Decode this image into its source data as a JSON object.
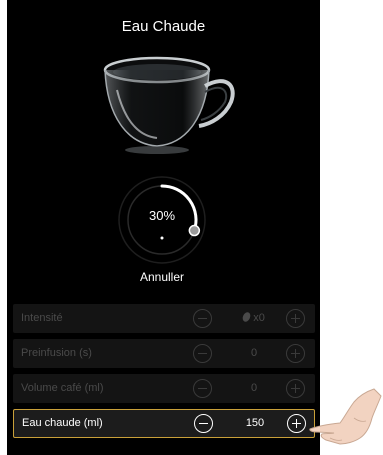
{
  "screen": {
    "title": "Eau Chaude"
  },
  "dial": {
    "percent_text": "30%",
    "progress": 0.3
  },
  "cancel_label": "Annuller",
  "settings": [
    {
      "label": "Intensité",
      "value": "x0",
      "icon": "coffee-bean-icon",
      "active": false
    },
    {
      "label": "Preinfusion (s)",
      "value": "0",
      "active": false
    },
    {
      "label": "Volume café (ml)",
      "value": "0",
      "active": false
    },
    {
      "label": "Eau chaude (ml)",
      "value": "150",
      "active": true
    }
  ],
  "colors": {
    "background": "#000000",
    "accent_border": "#c9a039",
    "active_text": "#ffffff",
    "inactive_text": "#4a4a4a"
  },
  "icons": {
    "decrement": "minus-circle-icon",
    "increment": "plus-circle-icon",
    "pointer": "hand-pointer-icon"
  }
}
